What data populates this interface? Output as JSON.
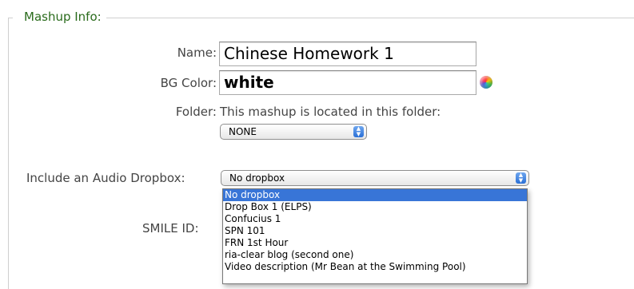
{
  "section": {
    "legend": "Mashup Info:"
  },
  "name": {
    "label": "Name:",
    "value": "Chinese Homework 1"
  },
  "bgcolor": {
    "label": "BG Color:",
    "value": "white",
    "icon": "color-picker-icon"
  },
  "folder": {
    "label": "Folder:",
    "text": "This mashup is located in this folder:",
    "selected": "NONE"
  },
  "dropbox": {
    "label": "Include an Audio Dropbox:",
    "selected": "No dropbox",
    "options": [
      "No dropbox",
      "Drop Box 1 (ELPS)",
      "Confucius 1",
      "SPN 101",
      "FRN 1st Hour",
      "ria-clear blog (second one)",
      "Video description (Mr Bean at the Swimming Pool)"
    ]
  },
  "smile": {
    "label": "SMILE ID:"
  },
  "colors": {
    "legend": "#2a6b1c",
    "highlight": "#3875d7"
  }
}
